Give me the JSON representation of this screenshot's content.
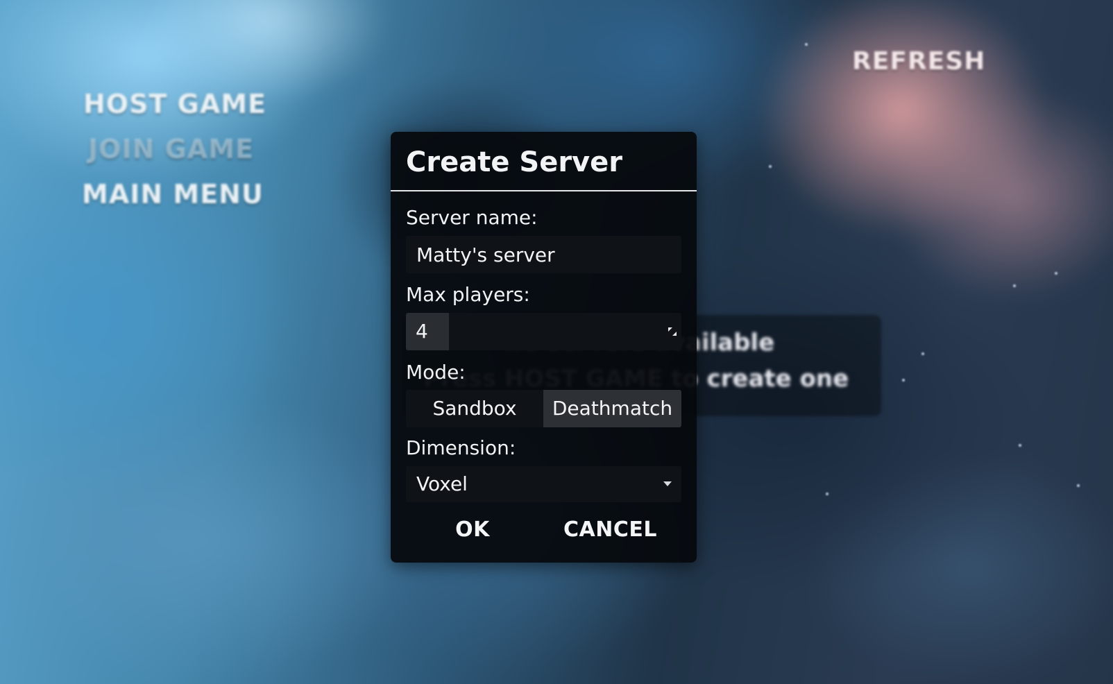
{
  "background_menu": {
    "host_game": "HOST GAME",
    "join_game": "JOIN GAME",
    "main_menu": "MAIN MENU",
    "refresh": "REFRESH",
    "no_servers": "No servers available",
    "press_host": "Press HOST GAME to create one"
  },
  "dialog": {
    "title": "Create Server",
    "server_name_label": "Server name:",
    "server_name_value": "Matty's server",
    "max_players_label": "Max players:",
    "max_players_value": "4",
    "mode_label": "Mode:",
    "mode_options": [
      "Sandbox",
      "Deathmatch"
    ],
    "mode_selected": "Deathmatch",
    "dimension_label": "Dimension:",
    "dimension_value": "Voxel",
    "ok_label": "OK",
    "cancel_label": "CANCEL"
  },
  "icons": {
    "resize": "resize-icon",
    "dropdown": "chevron-down-icon"
  },
  "colors": {
    "dialog_bg": "#06090e",
    "field_bg": "#0f1318",
    "selected_bg": "#2d3035",
    "text": "#f1f3f5"
  }
}
